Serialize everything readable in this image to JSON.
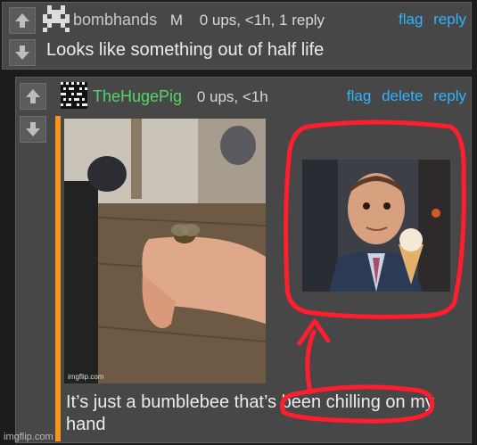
{
  "comment1": {
    "username": "bombhands",
    "badge": "M",
    "meta": "0 ups, <1h, 1 reply",
    "actions": {
      "flag": "flag",
      "reply": "reply"
    },
    "body": "Looks like something out of half life"
  },
  "comment2": {
    "username": "TheHugePig",
    "meta": "0 ups, <1h",
    "actions": {
      "flag": "flag",
      "delete": "delete",
      "reply": "reply"
    },
    "body": "It’s just a bumblebee that’s been chilling on my hand",
    "photo_watermark": "imgflip.com"
  },
  "footer": {
    "watermark": "imgflip.com"
  },
  "colors": {
    "link": "#2fb3ff",
    "username2": "#55d46a",
    "accent_bar": "#f7941d",
    "annotation": "#ff1e2d"
  },
  "icons": [
    "up-arrow-icon",
    "down-arrow-icon",
    "pixel-avatar-icon",
    "qr-avatar-icon"
  ]
}
